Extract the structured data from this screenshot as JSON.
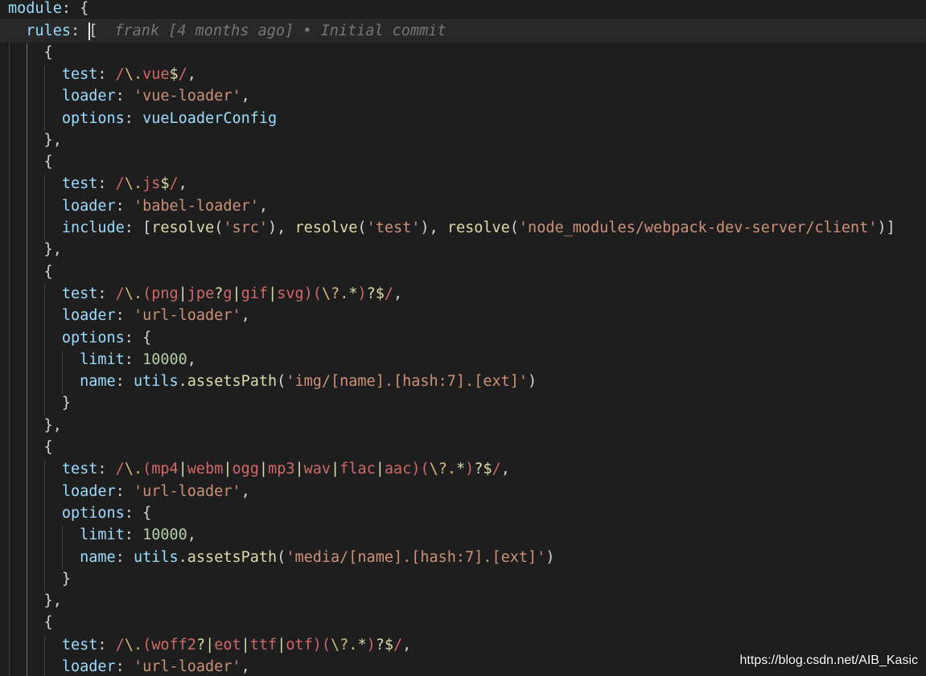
{
  "editor": {
    "lines": [
      [
        {
          "t": "module",
          "c": "k"
        },
        {
          "t": ": {",
          "c": "p"
        }
      ],
      [
        {
          "t": "  rules",
          "c": "k"
        },
        {
          "t": ": [",
          "c": "p"
        }
      ],
      [
        {
          "t": "    {",
          "c": "p"
        }
      ],
      [
        {
          "t": "      test",
          "c": "k"
        },
        {
          "t": ": ",
          "c": "p"
        },
        {
          "t": "/",
          "c": "r"
        },
        {
          "t": "\\.",
          "c": "re"
        },
        {
          "t": "vue",
          "c": "r"
        },
        {
          "t": "$",
          "c": "ro"
        },
        {
          "t": "/",
          "c": "r"
        },
        {
          "t": ",",
          "c": "p"
        }
      ],
      [
        {
          "t": "      loader",
          "c": "k"
        },
        {
          "t": ": ",
          "c": "p"
        },
        {
          "t": "'vue-loader'",
          "c": "s"
        },
        {
          "t": ",",
          "c": "p"
        }
      ],
      [
        {
          "t": "      options",
          "c": "k"
        },
        {
          "t": ": ",
          "c": "p"
        },
        {
          "t": "vueLoaderConfig",
          "c": "v"
        }
      ],
      [
        {
          "t": "    },",
          "c": "p"
        }
      ],
      [
        {
          "t": "    {",
          "c": "p"
        }
      ],
      [
        {
          "t": "      test",
          "c": "k"
        },
        {
          "t": ": ",
          "c": "p"
        },
        {
          "t": "/",
          "c": "r"
        },
        {
          "t": "\\.",
          "c": "re"
        },
        {
          "t": "js",
          "c": "r"
        },
        {
          "t": "$",
          "c": "ro"
        },
        {
          "t": "/",
          "c": "r"
        },
        {
          "t": ",",
          "c": "p"
        }
      ],
      [
        {
          "t": "      loader",
          "c": "k"
        },
        {
          "t": ": ",
          "c": "p"
        },
        {
          "t": "'babel-loader'",
          "c": "s"
        },
        {
          "t": ",",
          "c": "p"
        }
      ],
      [
        {
          "t": "      include",
          "c": "k"
        },
        {
          "t": ": [",
          "c": "p"
        },
        {
          "t": "resolve",
          "c": "f"
        },
        {
          "t": "(",
          "c": "p"
        },
        {
          "t": "'src'",
          "c": "s"
        },
        {
          "t": "), ",
          "c": "p"
        },
        {
          "t": "resolve",
          "c": "f"
        },
        {
          "t": "(",
          "c": "p"
        },
        {
          "t": "'test'",
          "c": "s"
        },
        {
          "t": "), ",
          "c": "p"
        },
        {
          "t": "resolve",
          "c": "f"
        },
        {
          "t": "(",
          "c": "p"
        },
        {
          "t": "'node_modules/webpack-dev-server/client'",
          "c": "s"
        },
        {
          "t": ")]",
          "c": "p"
        }
      ],
      [
        {
          "t": "    },",
          "c": "p"
        }
      ],
      [
        {
          "t": "    {",
          "c": "p"
        }
      ],
      [
        {
          "t": "      test",
          "c": "k"
        },
        {
          "t": ": ",
          "c": "p"
        },
        {
          "t": "/",
          "c": "r"
        },
        {
          "t": "\\.",
          "c": "re"
        },
        {
          "t": "(",
          "c": "r"
        },
        {
          "t": "png",
          "c": "r"
        },
        {
          "t": "|",
          "c": "ro"
        },
        {
          "t": "jpe",
          "c": "r"
        },
        {
          "t": "?",
          "c": "ro"
        },
        {
          "t": "g",
          "c": "r"
        },
        {
          "t": "|",
          "c": "ro"
        },
        {
          "t": "gif",
          "c": "r"
        },
        {
          "t": "|",
          "c": "ro"
        },
        {
          "t": "svg",
          "c": "r"
        },
        {
          "t": ")(",
          "c": "r"
        },
        {
          "t": "\\?",
          "c": "re"
        },
        {
          "t": ".",
          "c": "re"
        },
        {
          "t": "*",
          "c": "ro"
        },
        {
          "t": ")",
          "c": "r"
        },
        {
          "t": "?$",
          "c": "ro"
        },
        {
          "t": "/",
          "c": "r"
        },
        {
          "t": ",",
          "c": "p"
        }
      ],
      [
        {
          "t": "      loader",
          "c": "k"
        },
        {
          "t": ": ",
          "c": "p"
        },
        {
          "t": "'url-loader'",
          "c": "s"
        },
        {
          "t": ",",
          "c": "p"
        }
      ],
      [
        {
          "t": "      options",
          "c": "k"
        },
        {
          "t": ": {",
          "c": "p"
        }
      ],
      [
        {
          "t": "        limit",
          "c": "k"
        },
        {
          "t": ": ",
          "c": "p"
        },
        {
          "t": "10000",
          "c": "n"
        },
        {
          "t": ",",
          "c": "p"
        }
      ],
      [
        {
          "t": "        name",
          "c": "k"
        },
        {
          "t": ": ",
          "c": "p"
        },
        {
          "t": "utils",
          "c": "v"
        },
        {
          "t": ".",
          "c": "p"
        },
        {
          "t": "assetsPath",
          "c": "f"
        },
        {
          "t": "(",
          "c": "p"
        },
        {
          "t": "'img/[name].[hash:7].[ext]'",
          "c": "s"
        },
        {
          "t": ")",
          "c": "p"
        }
      ],
      [
        {
          "t": "      }",
          "c": "p"
        }
      ],
      [
        {
          "t": "    },",
          "c": "p"
        }
      ],
      [
        {
          "t": "    {",
          "c": "p"
        }
      ],
      [
        {
          "t": "      test",
          "c": "k"
        },
        {
          "t": ": ",
          "c": "p"
        },
        {
          "t": "/",
          "c": "r"
        },
        {
          "t": "\\.",
          "c": "re"
        },
        {
          "t": "(",
          "c": "r"
        },
        {
          "t": "mp4",
          "c": "r"
        },
        {
          "t": "|",
          "c": "ro"
        },
        {
          "t": "webm",
          "c": "r"
        },
        {
          "t": "|",
          "c": "ro"
        },
        {
          "t": "ogg",
          "c": "r"
        },
        {
          "t": "|",
          "c": "ro"
        },
        {
          "t": "mp3",
          "c": "r"
        },
        {
          "t": "|",
          "c": "ro"
        },
        {
          "t": "wav",
          "c": "r"
        },
        {
          "t": "|",
          "c": "ro"
        },
        {
          "t": "flac",
          "c": "r"
        },
        {
          "t": "|",
          "c": "ro"
        },
        {
          "t": "aac",
          "c": "r"
        },
        {
          "t": ")(",
          "c": "r"
        },
        {
          "t": "\\?",
          "c": "re"
        },
        {
          "t": ".",
          "c": "re"
        },
        {
          "t": "*",
          "c": "ro"
        },
        {
          "t": ")",
          "c": "r"
        },
        {
          "t": "?$",
          "c": "ro"
        },
        {
          "t": "/",
          "c": "r"
        },
        {
          "t": ",",
          "c": "p"
        }
      ],
      [
        {
          "t": "      loader",
          "c": "k"
        },
        {
          "t": ": ",
          "c": "p"
        },
        {
          "t": "'url-loader'",
          "c": "s"
        },
        {
          "t": ",",
          "c": "p"
        }
      ],
      [
        {
          "t": "      options",
          "c": "k"
        },
        {
          "t": ": {",
          "c": "p"
        }
      ],
      [
        {
          "t": "        limit",
          "c": "k"
        },
        {
          "t": ": ",
          "c": "p"
        },
        {
          "t": "10000",
          "c": "n"
        },
        {
          "t": ",",
          "c": "p"
        }
      ],
      [
        {
          "t": "        name",
          "c": "k"
        },
        {
          "t": ": ",
          "c": "p"
        },
        {
          "t": "utils",
          "c": "v"
        },
        {
          "t": ".",
          "c": "p"
        },
        {
          "t": "assetsPath",
          "c": "f"
        },
        {
          "t": "(",
          "c": "p"
        },
        {
          "t": "'media/[name].[hash:7].[ext]'",
          "c": "s"
        },
        {
          "t": ")",
          "c": "p"
        }
      ],
      [
        {
          "t": "      }",
          "c": "p"
        }
      ],
      [
        {
          "t": "    },",
          "c": "p"
        }
      ],
      [
        {
          "t": "    {",
          "c": "p"
        }
      ],
      [
        {
          "t": "      test",
          "c": "k"
        },
        {
          "t": ": ",
          "c": "p"
        },
        {
          "t": "/",
          "c": "r"
        },
        {
          "t": "\\.",
          "c": "re"
        },
        {
          "t": "(",
          "c": "r"
        },
        {
          "t": "woff2",
          "c": "r"
        },
        {
          "t": "?",
          "c": "ro"
        },
        {
          "t": "|",
          "c": "ro"
        },
        {
          "t": "eot",
          "c": "r"
        },
        {
          "t": "|",
          "c": "ro"
        },
        {
          "t": "ttf",
          "c": "r"
        },
        {
          "t": "|",
          "c": "ro"
        },
        {
          "t": "otf",
          "c": "r"
        },
        {
          "t": ")(",
          "c": "r"
        },
        {
          "t": "\\?",
          "c": "re"
        },
        {
          "t": ".",
          "c": "re"
        },
        {
          "t": "*",
          "c": "ro"
        },
        {
          "t": ")",
          "c": "r"
        },
        {
          "t": "?$",
          "c": "ro"
        },
        {
          "t": "/",
          "c": "r"
        },
        {
          "t": ",",
          "c": "p"
        }
      ],
      [
        {
          "t": "      loader",
          "c": "k"
        },
        {
          "t": ": ",
          "c": "p"
        },
        {
          "t": "'url-loader'",
          "c": "s"
        },
        {
          "t": ",",
          "c": "p"
        }
      ]
    ],
    "blame": "frank [4 months ago] • Initial commit"
  },
  "watermark": "https://blog.csdn.net/AIB_Kasic",
  "colors": {
    "background": "#1e1e1e",
    "property": "#9cdcfe",
    "string": "#ce9178",
    "regex": "#d16969",
    "regex_escape": "#d7ba7d",
    "number": "#b5cea8",
    "function": "#dcdcaa",
    "blame": "#777777"
  }
}
